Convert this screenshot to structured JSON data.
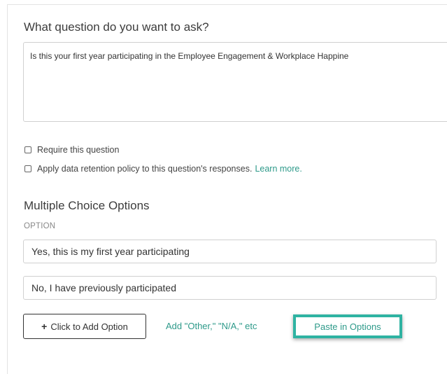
{
  "question": {
    "heading": "What question do you want to ask?",
    "text": "Is this your first year participating in the Employee Engagement & Workplace Happine"
  },
  "settings": {
    "require_label": "Require this question",
    "retention_label": "Apply data retention policy to this question's responses.",
    "learn_more": "Learn more."
  },
  "options_section": {
    "heading": "Multiple Choice Options",
    "column_label": "OPTION",
    "options": [
      "Yes,  this is my first year participating",
      "No, I have previously participated"
    ],
    "add_button_label": "Click to Add Option",
    "add_button_icon": "plus-icon",
    "other_link": "Add \"Other,\" \"N/A,\" etc",
    "paste_label": "Paste in Options"
  },
  "colors": {
    "accent": "#2e9a8a",
    "highlight_border": "#2fb3a2"
  }
}
